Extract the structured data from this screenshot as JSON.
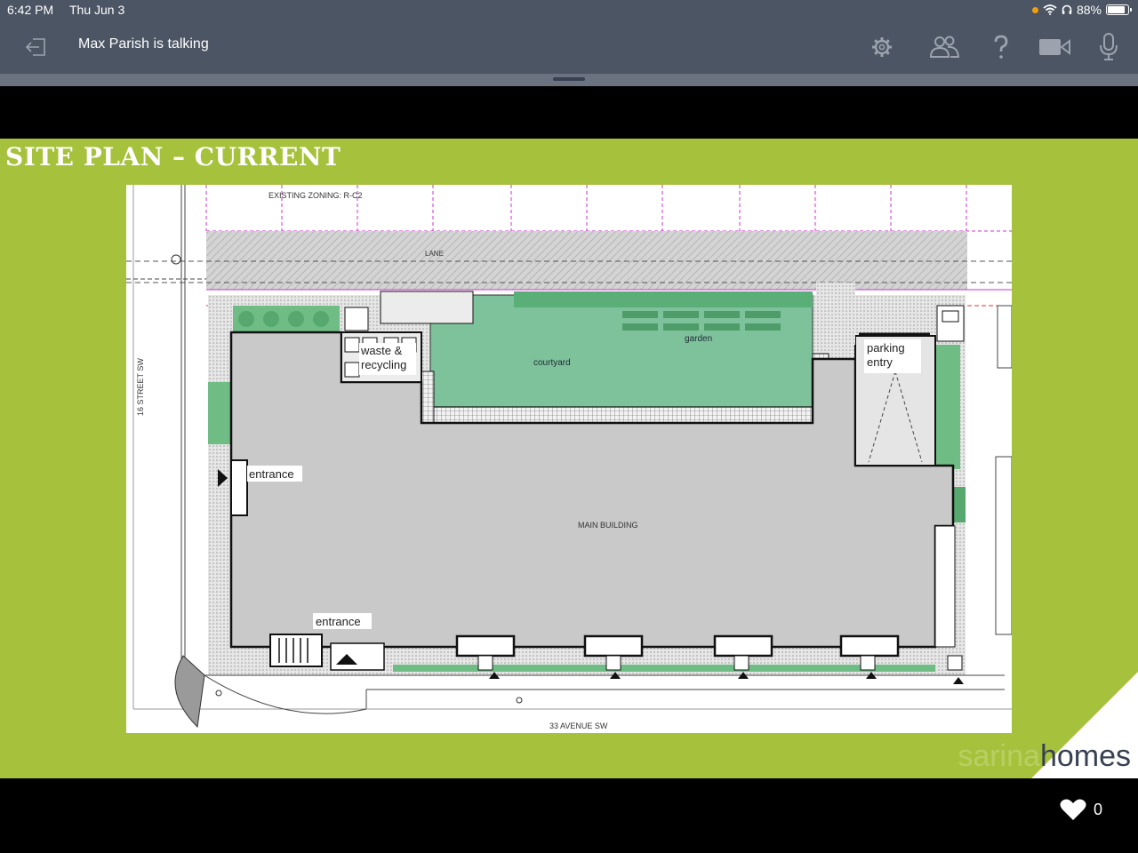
{
  "status_bar": {
    "time": "6:42 PM",
    "date": "Thu Jun 3",
    "battery": "88%",
    "battery_level": 0.88,
    "icons": [
      "orange-dot-icon",
      "wifi-icon",
      "headphones-icon",
      "battery-icon"
    ]
  },
  "toolbar": {
    "speaker_status": "Max Parish  is talking",
    "icons": [
      "exit-icon",
      "settings-gear-icon",
      "participants-icon",
      "help-icon",
      "video-camera-icon",
      "microphone-icon"
    ]
  },
  "slide": {
    "title": "SITE PLAN – CURRENT",
    "brand_part1": "sarina",
    "brand_part2": "homes",
    "plan_labels": {
      "zoning": "EXISTING ZONING: R-C2",
      "lane": "LANE",
      "street_west": "16 STREET SW",
      "street_south": "33 AVENUE SW",
      "waste_line1": "waste &",
      "waste_line2": "recycling",
      "courtyard": "courtyard",
      "garden": "garden",
      "parking_line1": "parking",
      "parking_line2": "entry",
      "entrance_west": "entrance",
      "entrance_south": "entrance",
      "main_building": "MAIN BUILDING"
    }
  },
  "colors": {
    "status_bg": "#4b5563",
    "slide_bg": "#a6c13c",
    "building": "#c9c9c9",
    "courtyard": "#7dc29a",
    "pink_line": "#cc33cc"
  },
  "likes": {
    "count": "0"
  }
}
